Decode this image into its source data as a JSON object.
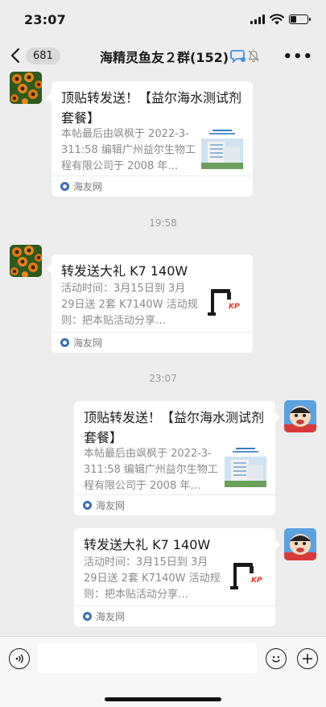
{
  "status_bar": {
    "time": "23:07",
    "battery_level": 0.35
  },
  "nav": {
    "back_count": "681",
    "title": "海精灵鱼友２群(152)",
    "more_label": "•••"
  },
  "messages": [
    {
      "title": "顶贴转发送！【益尔海水测试剂套餐】",
      "desc": "本帖最后由飒枫于 2022-3-311:58 编辑广州益尔生物工程有限公司于 2008 年…",
      "source": "海友网",
      "thumb": "building-photo"
    },
    {
      "title": "转发送大礼  K7 140W",
      "desc": "活动时间：3月15日到 3月29日送 2套 K7140W 活动规则：把本贴活动分享…",
      "source": "海友网",
      "thumb": "lamp-photo"
    },
    {
      "title": "顶贴转发送！【益尔海水测试剂套餐】",
      "desc": "本帖最后由飒枫于 2022-3-311:58 编辑广州益尔生物工程有限公司于 2008 年…",
      "source": "海友网",
      "thumb": "building-photo"
    },
    {
      "title": "转发送大礼  K7 140W",
      "desc": "活动时间：3月15日到 3月29日送 2套 K7140W 活动规则：把本贴活动分享…",
      "source": "海友网",
      "thumb": "lamp-photo"
    }
  ],
  "timestamps": [
    "19:58",
    "23:07"
  ],
  "input_bar": {
    "voice_icon": "voice-icon",
    "emoji_icon": "emoji-icon",
    "plus_icon": "plus-icon"
  },
  "colors": {
    "background": "#ededed",
    "bubble": "#ffffff",
    "subtext": "#8a8a8a",
    "accent_blue": "#3a8ee6"
  }
}
